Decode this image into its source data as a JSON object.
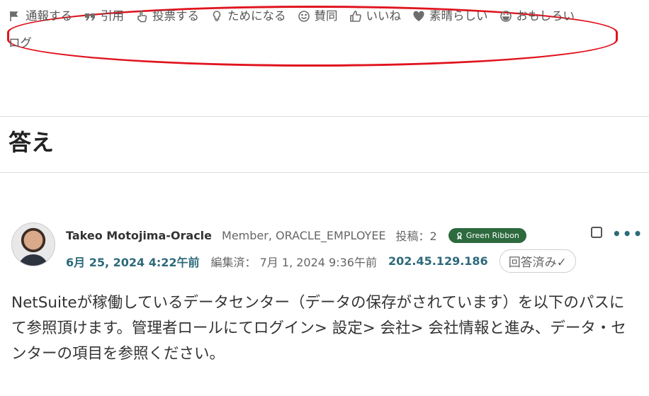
{
  "actions": [
    {
      "icon": "flag-icon",
      "label": "通報する"
    },
    {
      "icon": "quote-icon",
      "label": "引用"
    },
    {
      "icon": "vote-hand-icon",
      "label": "投票する"
    },
    {
      "icon": "lightbulb-icon",
      "label": "ためになる"
    },
    {
      "icon": "smile-icon",
      "label": "賛同"
    },
    {
      "icon": "thumbs-up-icon",
      "label": "いいね"
    },
    {
      "icon": "heart-icon",
      "label": "素晴らしい"
    },
    {
      "icon": "laugh-icon",
      "label": "おもしろい"
    }
  ],
  "actions_overflow": "ログ",
  "answers_heading": "答え",
  "post": {
    "author": "Takeo Motojima-Oracle",
    "role": "Member, ORACLE_EMPLOYEE",
    "posts": "投稿：2",
    "badge": "Green Ribbon",
    "date": "6月 25, 2024 4:22午前",
    "edited": "編集済： 7月 1, 2024 9:36午前",
    "ip": "202.45.129.186",
    "answered_label": "回答済み✓",
    "more_label": "•••",
    "body": "NetSuiteが稼働しているデータセンター（データの保存がされています）を以下のパスにて参照頂けます。管理者ロールにてログイン> 設定> 会社> 会社情報と進み、データ・センターの項目を参照ください。"
  },
  "colors": {
    "highlight": "#e0141e",
    "accent": "#2d6a7a",
    "badge": "#2d6a3e"
  }
}
